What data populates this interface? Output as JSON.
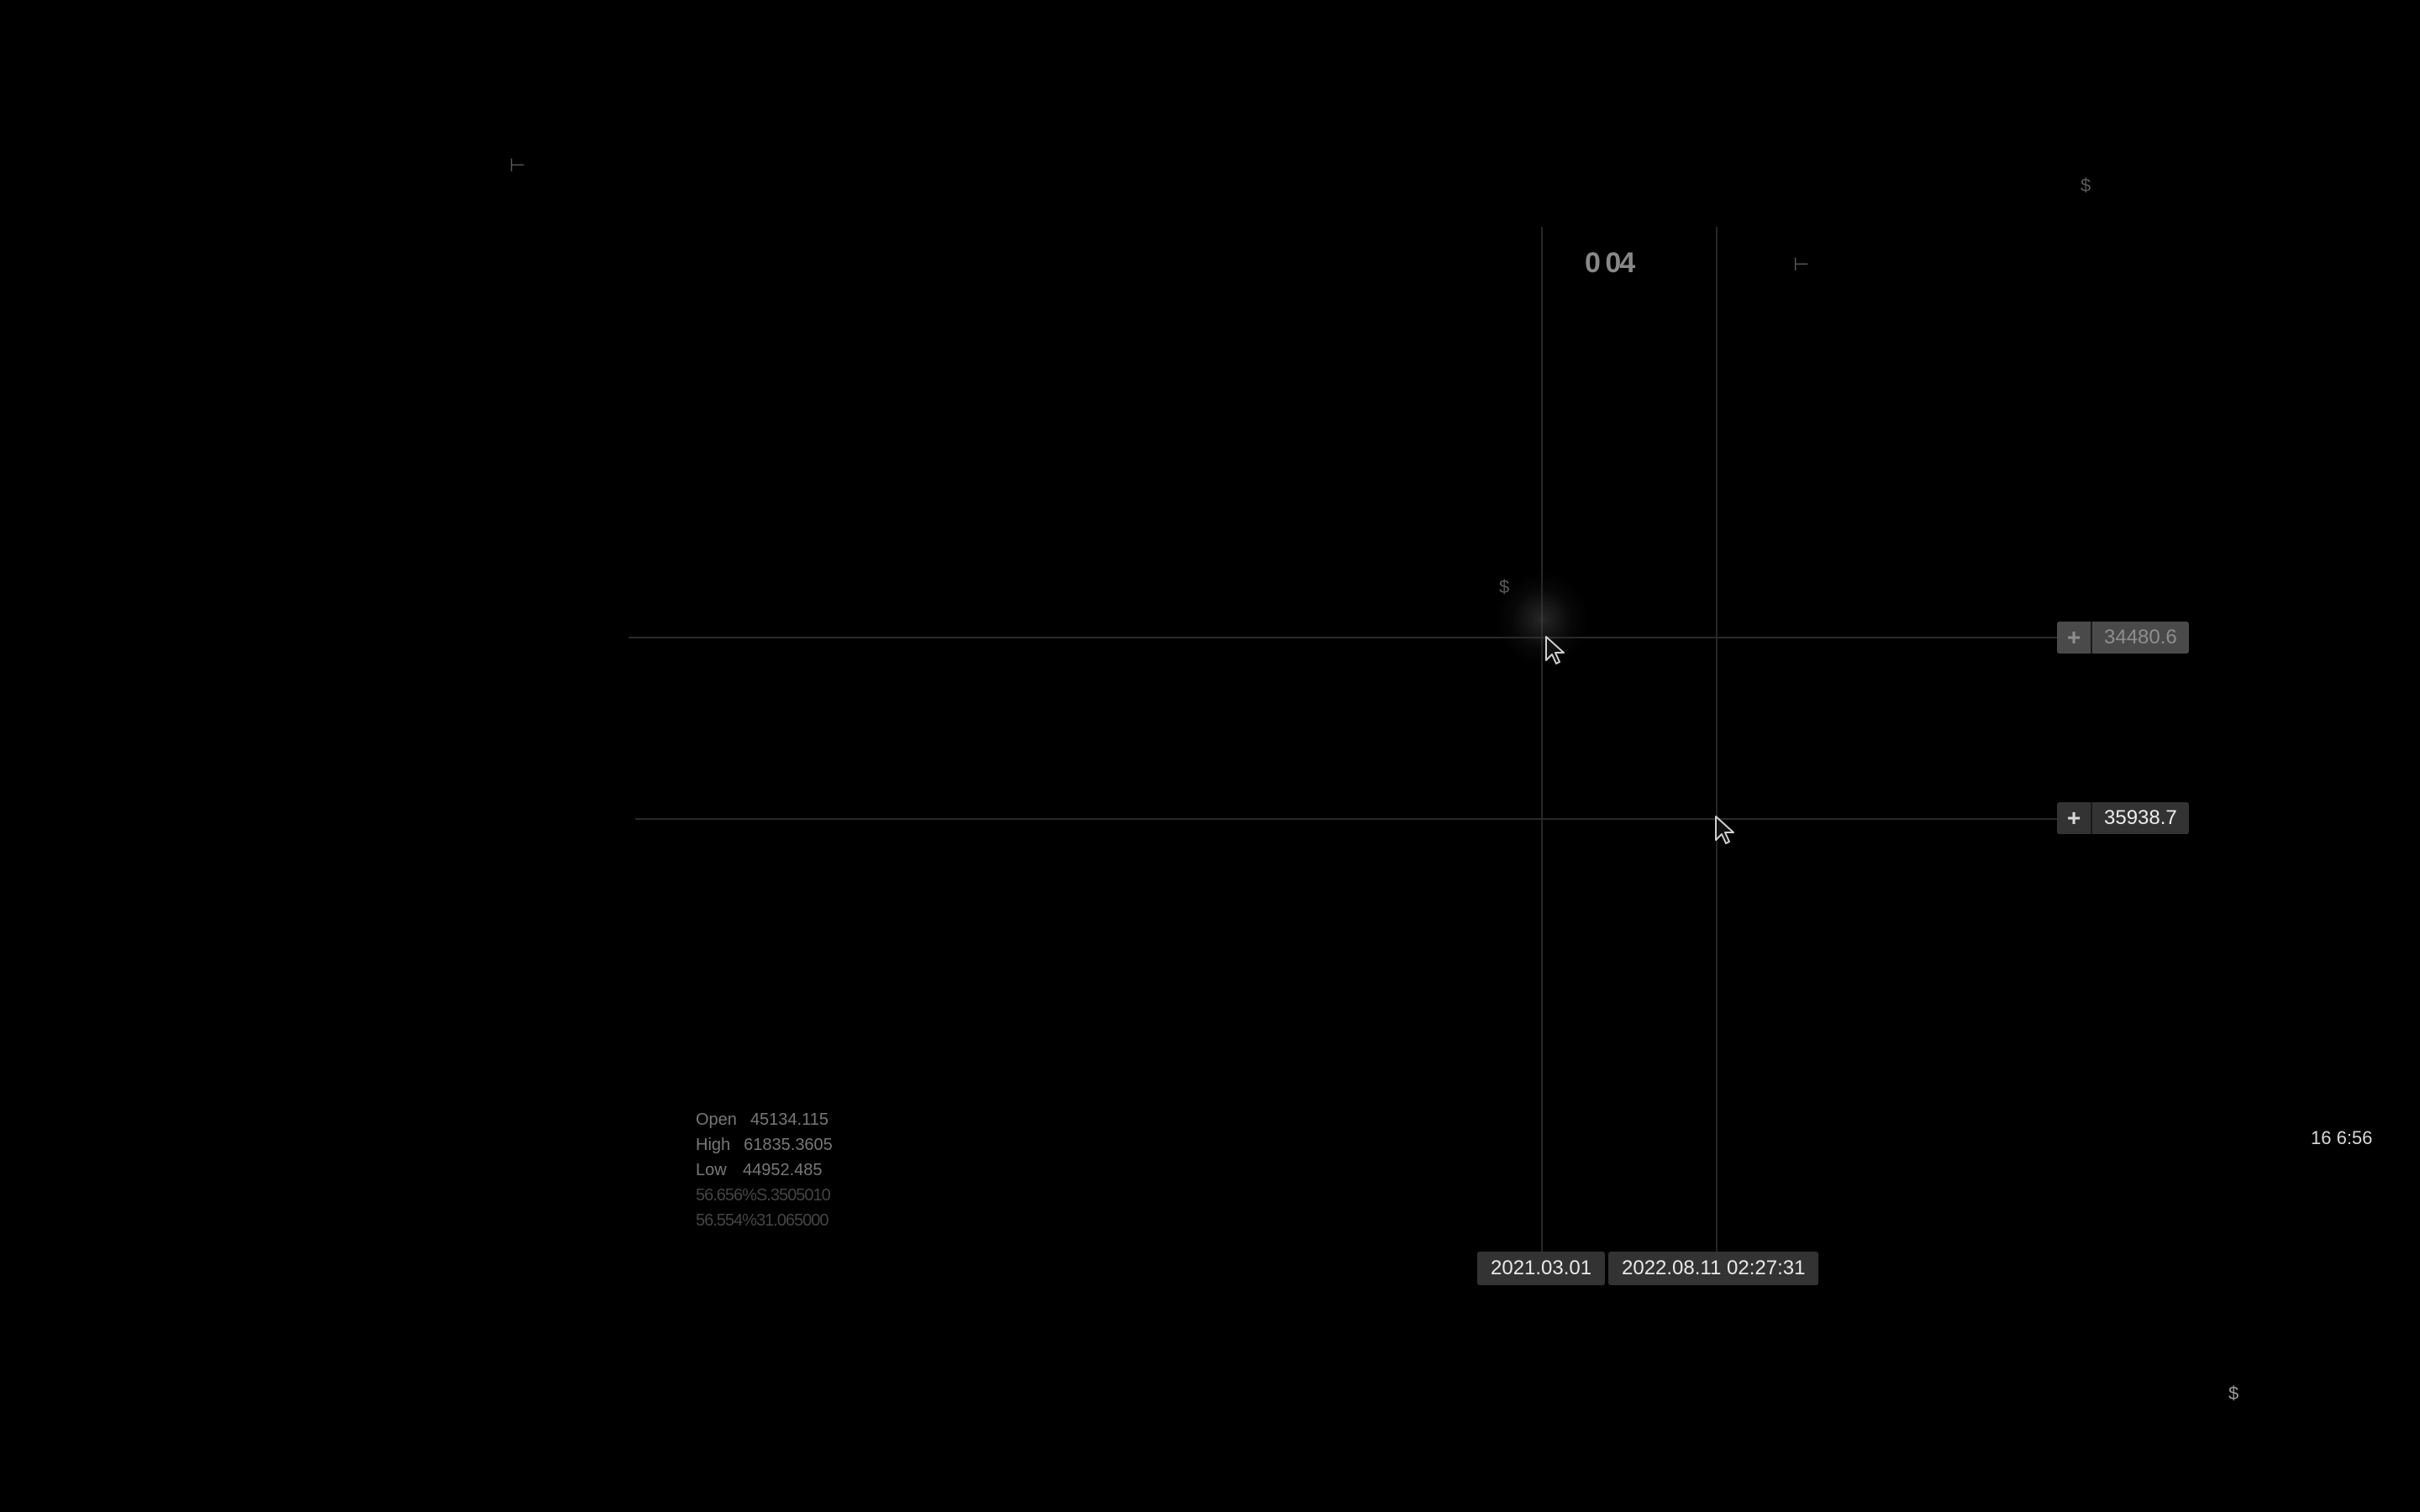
{
  "crosshairs": [
    {
      "price": "34480.6",
      "time": "2021.03.01"
    },
    {
      "price": "35938.7",
      "time": "2022.08.11 02:27:31"
    }
  ],
  "price_labels": {
    "primary_add": "+",
    "primary_value": "34480.6",
    "secondary_add": "+",
    "secondary_value": "35938.7"
  },
  "time_labels": {
    "primary": "2021.03.01",
    "secondary": "2022.08.11 02:27:31"
  },
  "ohlc": {
    "open_label": "Open",
    "open_value": "45134.115",
    "high_label": "High",
    "high_value": "61835.3605",
    "low_label": "Low",
    "low_value": "44952.485",
    "close_row_garbled": "56.656%S.3505010",
    "change_row_garbled": "56.554%31.065000"
  },
  "artifacts": {
    "top_center_ghost": "0 04",
    "corner_readout": "16 6:56"
  },
  "colors": {
    "background": "#000000",
    "crosshair": "#2a2a2a",
    "label_bg": "#333333",
    "label_text": "#ececec",
    "ohlc_text": "#777777"
  },
  "icons": [
    "cursor-arrow-icon",
    "plus-icon",
    "dollar-icon",
    "pin-icon"
  ]
}
